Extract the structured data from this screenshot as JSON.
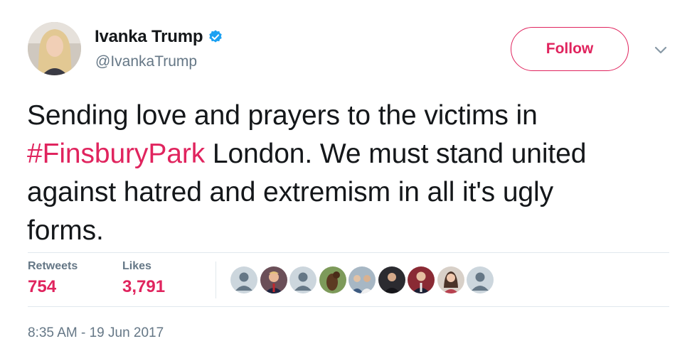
{
  "user": {
    "name": "Ivanka Trump",
    "handle": "@IvankaTrump",
    "verified": true
  },
  "follow_button": {
    "label": "Follow"
  },
  "tweet": {
    "line1": "Sending love and prayers to the victims in",
    "hashtag": "#FinsburyPark",
    "line2_rest": " London. We must stand united",
    "line3": "against hatred and extremism in all it's ugly",
    "line4": "forms."
  },
  "stats": {
    "retweets_label": "Retweets",
    "retweets_value": "754",
    "likes_label": "Likes",
    "likes_value": "3,791"
  },
  "likers": [
    {
      "name": "default-avatar-icon",
      "kind": "default"
    },
    {
      "name": "avatar",
      "kind": "red"
    },
    {
      "name": "default-avatar-icon",
      "kind": "default"
    },
    {
      "name": "avatar",
      "kind": "horse"
    },
    {
      "name": "avatar",
      "kind": "group"
    },
    {
      "name": "avatar",
      "kind": "dark"
    },
    {
      "name": "avatar",
      "kind": "suit"
    },
    {
      "name": "avatar",
      "kind": "woman"
    },
    {
      "name": "default-avatar-icon",
      "kind": "default"
    }
  ],
  "timestamp": "8:35 AM - 19 Jun 2017",
  "colors": {
    "accent": "#e0245e",
    "verified": "#1da1f2",
    "muted": "#657786",
    "divider": "#e1e8ed"
  }
}
